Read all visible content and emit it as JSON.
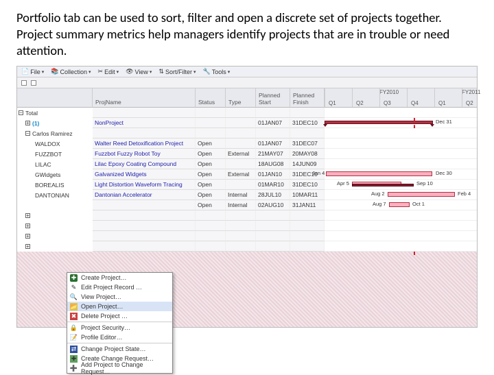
{
  "caption": "Portfolio tab can be used to sort, filter and open a discrete set of projects together.  Project summary metrics help managers identify projects that are in trouble or need attention.",
  "toolbar": {
    "file": "File",
    "collection": "Collection",
    "edit": "Edit",
    "view": "View",
    "sortfilter": "Sort/Filter",
    "tools": "Tools"
  },
  "columns": {
    "blank": "",
    "projname": "ProjName",
    "status": "Status",
    "type": "Type",
    "pstart": "Planned Start",
    "pfin": "Planned Finish"
  },
  "timeline": {
    "fy": [
      "FY2010",
      "FY2011"
    ],
    "quarters": [
      "Q1",
      "Q2",
      "Q3",
      "Q4",
      "Q1",
      "Q2"
    ]
  },
  "tree": {
    "total": "Total",
    "group1": "(1)",
    "owner": "Carlos Ramirez"
  },
  "rows": [
    {
      "code": "",
      "name": "NonProject",
      "status": "",
      "type": "",
      "start": "01JAN07",
      "fin": "31DEC10"
    },
    {
      "code": "WALDOX",
      "name": "Walter Reed Detoxification Project",
      "status": "Open",
      "type": "",
      "start": "01JAN07",
      "fin": "31DEC07"
    },
    {
      "code": "FUZZBOT",
      "name": "Fuzzbot Fuzzy Robot Toy",
      "status": "Open",
      "type": "External",
      "start": "21MAY07",
      "fin": "20MAY08"
    },
    {
      "code": "LILAC",
      "name": "Lilac Epoxy Coating Compound",
      "status": "Open",
      "type": "",
      "start": "18AUG08",
      "fin": "14JUN09"
    },
    {
      "code": "GWidgets",
      "name": "Galvanized Widgets",
      "status": "Open",
      "type": "External",
      "start": "01JAN10",
      "fin": "31DEC10"
    },
    {
      "code": "BOREALIS",
      "name": "Light Distortion Waveform Tracing",
      "status": "Open",
      "type": "",
      "start": "01MAR10",
      "fin": "31DEC10"
    },
    {
      "code": "DANTONIAN",
      "name": "Dantonian Accelerator",
      "status": "Open",
      "type": "Internal",
      "start": "28JUL10",
      "fin": "10MAR11"
    },
    {
      "code": "",
      "name": "",
      "status": "Open",
      "type": "Internal",
      "start": "02AUG10",
      "fin": "31JAN11"
    }
  ],
  "ganttLabels": {
    "dec31": "Dec 31",
    "jan4": "Jan 4",
    "dec30": "Dec 30",
    "apr5": "Apr 5",
    "sep10": "Sep 10",
    "aug2": "Aug 2",
    "feb4": "Feb 4",
    "aug7": "Aug 7",
    "oct1": "Oct 1"
  },
  "contextMenu": {
    "create": "Create Project…",
    "editrec": "Edit Project Record …",
    "view": "View Project…",
    "open": "Open Project…",
    "delete": "Delete Project …",
    "security": "Project Security…",
    "profile": "Profile Editor…",
    "state": "Change Project State…",
    "changereq": "Create Change Request…",
    "addchange": "Add Project to Change Request…"
  }
}
